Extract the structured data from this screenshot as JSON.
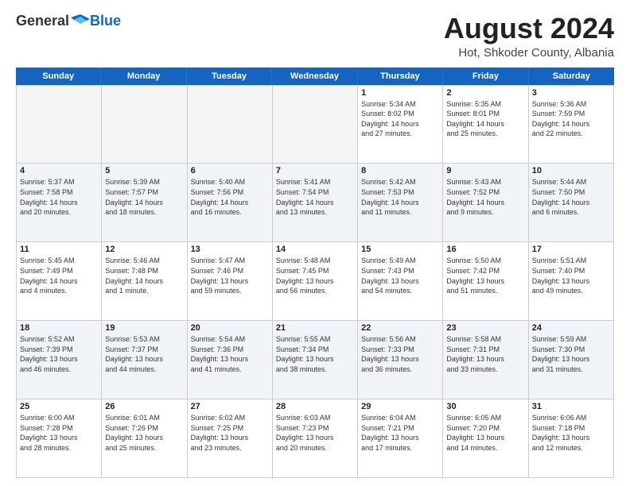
{
  "logo": {
    "general": "General",
    "blue": "Blue"
  },
  "title": "August 2024",
  "location": "Hot, Shkoder County, Albania",
  "header_days": [
    "Sunday",
    "Monday",
    "Tuesday",
    "Wednesday",
    "Thursday",
    "Friday",
    "Saturday"
  ],
  "weeks": [
    [
      {
        "day": "",
        "info": ""
      },
      {
        "day": "",
        "info": ""
      },
      {
        "day": "",
        "info": ""
      },
      {
        "day": "",
        "info": ""
      },
      {
        "day": "1",
        "info": "Sunrise: 5:34 AM\nSunset: 8:02 PM\nDaylight: 14 hours\nand 27 minutes."
      },
      {
        "day": "2",
        "info": "Sunrise: 5:35 AM\nSunset: 8:01 PM\nDaylight: 14 hours\nand 25 minutes."
      },
      {
        "day": "3",
        "info": "Sunrise: 5:36 AM\nSunset: 7:59 PM\nDaylight: 14 hours\nand 22 minutes."
      }
    ],
    [
      {
        "day": "4",
        "info": "Sunrise: 5:37 AM\nSunset: 7:58 PM\nDaylight: 14 hours\nand 20 minutes."
      },
      {
        "day": "5",
        "info": "Sunrise: 5:39 AM\nSunset: 7:57 PM\nDaylight: 14 hours\nand 18 minutes."
      },
      {
        "day": "6",
        "info": "Sunrise: 5:40 AM\nSunset: 7:56 PM\nDaylight: 14 hours\nand 16 minutes."
      },
      {
        "day": "7",
        "info": "Sunrise: 5:41 AM\nSunset: 7:54 PM\nDaylight: 14 hours\nand 13 minutes."
      },
      {
        "day": "8",
        "info": "Sunrise: 5:42 AM\nSunset: 7:53 PM\nDaylight: 14 hours\nand 11 minutes."
      },
      {
        "day": "9",
        "info": "Sunrise: 5:43 AM\nSunset: 7:52 PM\nDaylight: 14 hours\nand 9 minutes."
      },
      {
        "day": "10",
        "info": "Sunrise: 5:44 AM\nSunset: 7:50 PM\nDaylight: 14 hours\nand 6 minutes."
      }
    ],
    [
      {
        "day": "11",
        "info": "Sunrise: 5:45 AM\nSunset: 7:49 PM\nDaylight: 14 hours\nand 4 minutes."
      },
      {
        "day": "12",
        "info": "Sunrise: 5:46 AM\nSunset: 7:48 PM\nDaylight: 14 hours\nand 1 minute."
      },
      {
        "day": "13",
        "info": "Sunrise: 5:47 AM\nSunset: 7:46 PM\nDaylight: 13 hours\nand 59 minutes."
      },
      {
        "day": "14",
        "info": "Sunrise: 5:48 AM\nSunset: 7:45 PM\nDaylight: 13 hours\nand 56 minutes."
      },
      {
        "day": "15",
        "info": "Sunrise: 5:49 AM\nSunset: 7:43 PM\nDaylight: 13 hours\nand 54 minutes."
      },
      {
        "day": "16",
        "info": "Sunrise: 5:50 AM\nSunset: 7:42 PM\nDaylight: 13 hours\nand 51 minutes."
      },
      {
        "day": "17",
        "info": "Sunrise: 5:51 AM\nSunset: 7:40 PM\nDaylight: 13 hours\nand 49 minutes."
      }
    ],
    [
      {
        "day": "18",
        "info": "Sunrise: 5:52 AM\nSunset: 7:39 PM\nDaylight: 13 hours\nand 46 minutes."
      },
      {
        "day": "19",
        "info": "Sunrise: 5:53 AM\nSunset: 7:37 PM\nDaylight: 13 hours\nand 44 minutes."
      },
      {
        "day": "20",
        "info": "Sunrise: 5:54 AM\nSunset: 7:36 PM\nDaylight: 13 hours\nand 41 minutes."
      },
      {
        "day": "21",
        "info": "Sunrise: 5:55 AM\nSunset: 7:34 PM\nDaylight: 13 hours\nand 38 minutes."
      },
      {
        "day": "22",
        "info": "Sunrise: 5:56 AM\nSunset: 7:33 PM\nDaylight: 13 hours\nand 36 minutes."
      },
      {
        "day": "23",
        "info": "Sunrise: 5:58 AM\nSunset: 7:31 PM\nDaylight: 13 hours\nand 33 minutes."
      },
      {
        "day": "24",
        "info": "Sunrise: 5:59 AM\nSunset: 7:30 PM\nDaylight: 13 hours\nand 31 minutes."
      }
    ],
    [
      {
        "day": "25",
        "info": "Sunrise: 6:00 AM\nSunset: 7:28 PM\nDaylight: 13 hours\nand 28 minutes."
      },
      {
        "day": "26",
        "info": "Sunrise: 6:01 AM\nSunset: 7:26 PM\nDaylight: 13 hours\nand 25 minutes."
      },
      {
        "day": "27",
        "info": "Sunrise: 6:02 AM\nSunset: 7:25 PM\nDaylight: 13 hours\nand 23 minutes."
      },
      {
        "day": "28",
        "info": "Sunrise: 6:03 AM\nSunset: 7:23 PM\nDaylight: 13 hours\nand 20 minutes."
      },
      {
        "day": "29",
        "info": "Sunrise: 6:04 AM\nSunset: 7:21 PM\nDaylight: 13 hours\nand 17 minutes."
      },
      {
        "day": "30",
        "info": "Sunrise: 6:05 AM\nSunset: 7:20 PM\nDaylight: 13 hours\nand 14 minutes."
      },
      {
        "day": "31",
        "info": "Sunrise: 6:06 AM\nSunset: 7:18 PM\nDaylight: 13 hours\nand 12 minutes."
      }
    ]
  ],
  "alt_rows": [
    1,
    3
  ]
}
